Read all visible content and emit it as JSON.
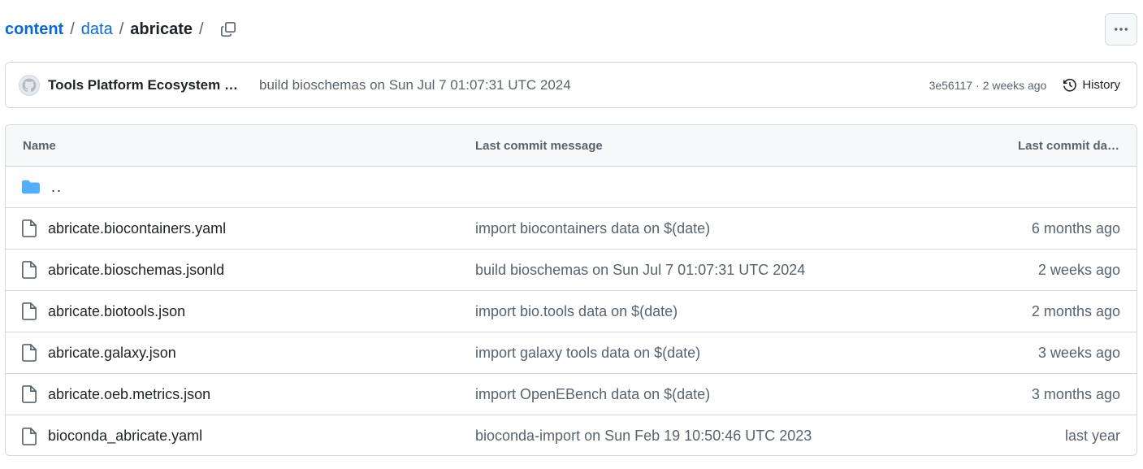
{
  "breadcrumb": {
    "items": [
      "content",
      "data"
    ],
    "current": "abricate",
    "separator": "/"
  },
  "commit": {
    "author": "Tools Platform Ecosystem …",
    "message": "build bioschemas on Sun Jul 7 01:07:31 UTC 2024",
    "sha": "3e56117",
    "dot": "·",
    "age": "2 weeks ago",
    "history_label": "History"
  },
  "table": {
    "headers": {
      "name": "Name",
      "message": "Last commit message",
      "date": "Last commit da…"
    },
    "parent_label": "..",
    "rows": [
      {
        "name": "abricate.biocontainers.yaml",
        "message": "import biocontainers data on $(date)",
        "date": "6 months ago"
      },
      {
        "name": "abricate.bioschemas.jsonld",
        "message": "build bioschemas on Sun Jul 7 01:07:31 UTC 2024",
        "date": "2 weeks ago"
      },
      {
        "name": "abricate.biotools.json",
        "message": "import bio.tools data on $(date)",
        "date": "2 months ago"
      },
      {
        "name": "abricate.galaxy.json",
        "message": "import galaxy tools data on $(date)",
        "date": "3 weeks ago"
      },
      {
        "name": "abricate.oeb.metrics.json",
        "message": "import OpenEBench data on $(date)",
        "date": "3 months ago"
      },
      {
        "name": "bioconda_abricate.yaml",
        "message": "bioconda-import on Sun Feb 19 10:50:46 UTC 2023",
        "date": "last year"
      }
    ]
  },
  "icons": {
    "copy": "copy-icon",
    "more": "kebab-horizontal-icon",
    "history": "history-icon",
    "folder": "folder-icon",
    "file": "file-icon"
  },
  "colors": {
    "link": "#0969da",
    "folder": "#54aeff",
    "muted": "#59636e",
    "border": "#d1d9e0",
    "header_bg": "#f6f8fa"
  }
}
